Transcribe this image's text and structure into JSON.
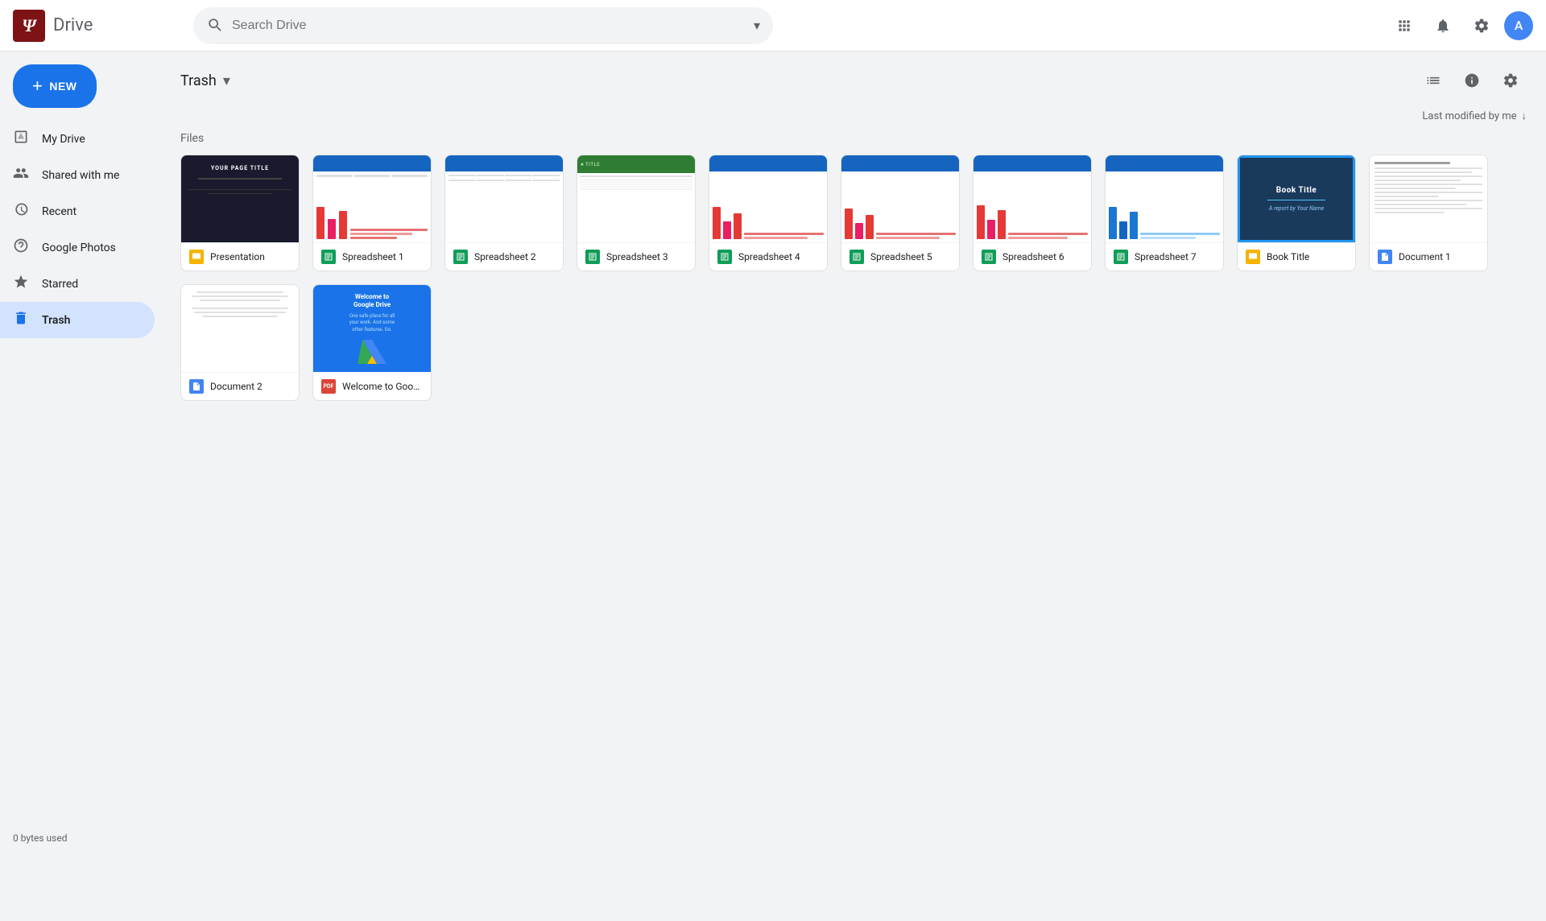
{
  "header": {
    "logo_letter": "Ψ",
    "app_name": "Drive",
    "search_placeholder": "Search Drive"
  },
  "sidebar": {
    "new_button": "NEW",
    "nav_items": [
      {
        "id": "my-drive",
        "label": "My Drive",
        "icon": "🗂"
      },
      {
        "id": "shared-with-me",
        "label": "Shared with me",
        "icon": "👥"
      },
      {
        "id": "recent",
        "label": "Recent",
        "icon": "🕐"
      },
      {
        "id": "google-photos",
        "label": "Google Photos",
        "icon": "⭐"
      },
      {
        "id": "starred",
        "label": "Starred",
        "icon": "★"
      },
      {
        "id": "trash",
        "label": "Trash",
        "icon": "🗑"
      }
    ],
    "storage_text": "0 bytes used"
  },
  "main": {
    "page_title": "Trash",
    "section_label": "Files",
    "sort_label": "Last modified by me",
    "files": [
      {
        "id": 1,
        "name": "Presentation",
        "type": "slides",
        "thumb": "slides-dark"
      },
      {
        "id": 2,
        "name": "Spreadsheet 1",
        "type": "sheets",
        "thumb": "sheets-chart"
      },
      {
        "id": 3,
        "name": "Spreadsheet 2",
        "type": "sheets",
        "thumb": "sheets-empty"
      },
      {
        "id": 4,
        "name": "Spreadsheet 3",
        "type": "sheets",
        "thumb": "sheets-green"
      },
      {
        "id": 5,
        "name": "Spreadsheet 4",
        "type": "sheets",
        "thumb": "sheets-chart"
      },
      {
        "id": 6,
        "name": "Spreadsheet 5",
        "type": "sheets",
        "thumb": "sheets-chart"
      },
      {
        "id": 7,
        "name": "Spreadsheet 6",
        "type": "sheets",
        "thumb": "sheets-chart"
      },
      {
        "id": 8,
        "name": "Spreadsheet 7",
        "type": "sheets",
        "thumb": "sheets-chart-blue"
      },
      {
        "id": 9,
        "name": "Book Title",
        "type": "slides",
        "thumb": "book-slides"
      },
      {
        "id": 10,
        "name": "Document 1",
        "type": "docs",
        "thumb": "doc-text"
      },
      {
        "id": 11,
        "name": "Document 2",
        "type": "docs",
        "thumb": "doc-empty"
      },
      {
        "id": 12,
        "name": "Welcome to Google Drive",
        "type": "pdf",
        "thumb": "gdrive-pdf"
      }
    ]
  }
}
